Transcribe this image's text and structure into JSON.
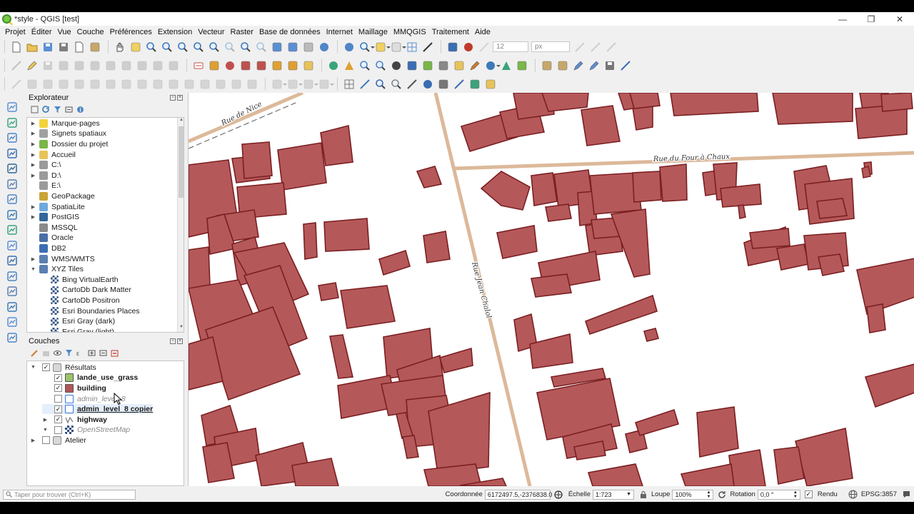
{
  "window": {
    "title": "*style - QGIS [test]",
    "minimize": "—",
    "maximize": "❐",
    "close": "✕"
  },
  "menu": [
    "Projet",
    "Éditer",
    "Vue",
    "Couche",
    "Préférences",
    "Extension",
    "Vecteur",
    "Raster",
    "Base de données",
    "Internet",
    "Maillage",
    "MMQGIS",
    "Traitement",
    "Aide"
  ],
  "toolbar": {
    "font_size": "12",
    "font_unit": "px"
  },
  "browser": {
    "title": "Explorateur",
    "items": [
      {
        "label": "Marque-pages",
        "icon": "star-icon",
        "expand": true,
        "indent": 0,
        "color": "#f2d23b"
      },
      {
        "label": "Signets spatiaux",
        "icon": "spatial-bookmark-icon",
        "expand": true,
        "indent": 0,
        "color": "#a0a0a0"
      },
      {
        "label": "Dossier du projet",
        "icon": "project-folder-icon",
        "expand": true,
        "indent": 0,
        "color": "#7ab648"
      },
      {
        "label": "Accueil",
        "icon": "home-folder-icon",
        "expand": true,
        "indent": 0,
        "color": "#e8c35a"
      },
      {
        "label": "C:\\",
        "icon": "drive-icon",
        "expand": true,
        "indent": 0,
        "color": "#9a9a9a"
      },
      {
        "label": "D:\\",
        "icon": "drive-icon",
        "expand": true,
        "indent": 0,
        "color": "#9a9a9a"
      },
      {
        "label": "E:\\",
        "icon": "drive-icon",
        "expand": false,
        "indent": 0,
        "color": "#9a9a9a"
      },
      {
        "label": "GeoPackage",
        "icon": "geopackage-icon",
        "expand": false,
        "indent": 0,
        "color": "#c9a437"
      },
      {
        "label": "SpatiaLite",
        "icon": "spatialite-icon",
        "expand": true,
        "indent": 0,
        "color": "#6fa8dc"
      },
      {
        "label": "PostGIS",
        "icon": "postgis-icon",
        "expand": true,
        "indent": 0,
        "color": "#336699"
      },
      {
        "label": "MSSQL",
        "icon": "mssql-icon",
        "expand": false,
        "indent": 0,
        "color": "#8a8a8a"
      },
      {
        "label": "Oracle",
        "icon": "oracle-icon",
        "expand": false,
        "indent": 0,
        "color": "#4a6fa5"
      },
      {
        "label": "DB2",
        "icon": "db2-icon",
        "expand": false,
        "indent": 0,
        "color": "#3b6db3"
      },
      {
        "label": "WMS/WMTS",
        "icon": "wms-globe-icon",
        "expand": true,
        "indent": 0,
        "color": "#5b7fb0"
      },
      {
        "label": "XYZ Tiles",
        "icon": "xyz-tiles-icon",
        "expand": "open",
        "indent": 0,
        "color": "#5b7fb0"
      },
      {
        "label": "Bing VirtualEarth",
        "icon": "tile-layer-icon",
        "expand": false,
        "indent": 1,
        "color": "#2f4f7f"
      },
      {
        "label": "CartoDb Dark Matter",
        "icon": "tile-layer-icon",
        "expand": false,
        "indent": 1,
        "color": "#2f4f7f"
      },
      {
        "label": "CartoDb Positron",
        "icon": "tile-layer-icon",
        "expand": false,
        "indent": 1,
        "color": "#2f4f7f"
      },
      {
        "label": "Esri Boundaries Places",
        "icon": "tile-layer-icon",
        "expand": false,
        "indent": 1,
        "color": "#2f4f7f"
      },
      {
        "label": "Esri Gray (dark)",
        "icon": "tile-layer-icon",
        "expand": false,
        "indent": 1,
        "color": "#2f4f7f"
      },
      {
        "label": "Esri Gray (light)",
        "icon": "tile-layer-icon",
        "expand": false,
        "indent": 1,
        "color": "#2f4f7f"
      }
    ]
  },
  "layers": {
    "title": "Couches",
    "items": [
      {
        "label": "Résultats",
        "type": "group",
        "checked": true,
        "expand": "open",
        "indent": 0,
        "style": "normal"
      },
      {
        "label": "lande_use_grass",
        "type": "polygon",
        "checked": true,
        "expand": false,
        "indent": 1,
        "style": "bold",
        "color": "#9bc26b"
      },
      {
        "label": "building",
        "type": "polygon",
        "checked": true,
        "expand": false,
        "indent": 1,
        "style": "bold",
        "color": "#b45555"
      },
      {
        "label": "admin_level_8",
        "type": "outline",
        "checked": false,
        "expand": false,
        "indent": 1,
        "style": "italic",
        "color": "#3c78d8"
      },
      {
        "label": "admin_level_8 copier",
        "type": "outline",
        "checked": true,
        "expand": false,
        "indent": 1,
        "style": "bold-underline",
        "color": "#3c78d8"
      },
      {
        "label": "highway",
        "type": "line",
        "checked": true,
        "expand": true,
        "indent": 1,
        "style": "bold",
        "color": "#777777"
      },
      {
        "label": "OpenStreetMap",
        "type": "tiles",
        "checked": false,
        "expand": "open",
        "indent": 1,
        "style": "italic",
        "color": "#2f4f7f"
      },
      {
        "label": "Atelier",
        "type": "group",
        "checked": false,
        "expand": true,
        "indent": 0,
        "style": "normal"
      }
    ]
  },
  "map": {
    "labels": [
      "Rue de Nice",
      "Rue du Four à Chaux",
      "Rue Jean Chalol"
    ],
    "building_fill": "#b5585a",
    "building_stroke": "#7a1f22",
    "road_color": "#dcb99a"
  },
  "status": {
    "locator_placeholder": "Taper pour trouver (Ctrl+K)",
    "coord_label": "Coordonnée",
    "coord_value": "6172497.5,-2376838.0",
    "scale_label": "Échelle",
    "scale_value": "1:723",
    "magnifier_label": "Loupe",
    "magnifier_value": "100%",
    "rotation_label": "Rotation",
    "rotation_value": "0,0 °",
    "render_label": "Rendu",
    "crs": "EPSG:3857"
  }
}
